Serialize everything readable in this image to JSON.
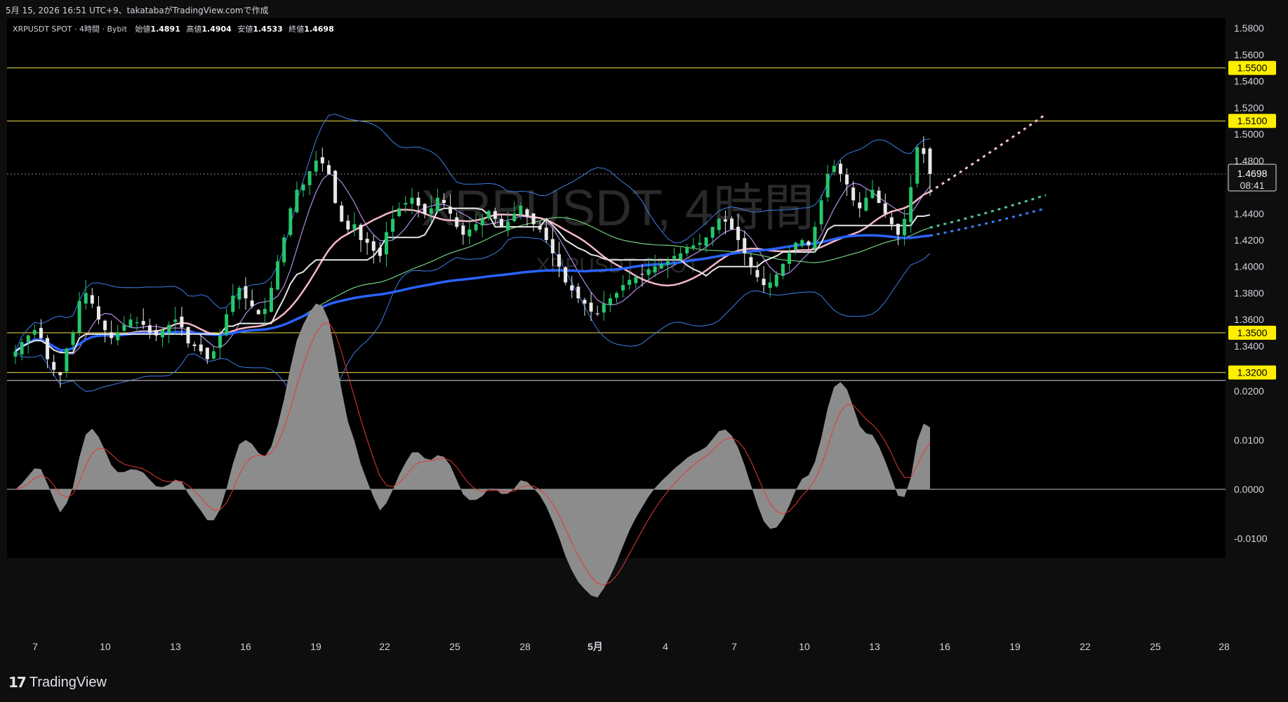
{
  "header": {
    "attribution": "5月 15, 2026 16:51 UTC+9、takatabaがTradingView.comで作成"
  },
  "legend": {
    "symbol": "XRPUSDT SPOT · 4時間 · Bybit",
    "open_label": "始値",
    "open": "1.4891",
    "high_label": "高値",
    "high": "1.4904",
    "low_label": "安値",
    "low": "1.4533",
    "close_label": "終値",
    "close": "1.4698"
  },
  "watermark": {
    "main": "XRPUSDT, 4時間",
    "sub": "XRPUSDT SPOT"
  },
  "footer": {
    "brand": "TradingView"
  },
  "colors": {
    "up": "#26c66a",
    "down": "#e8e8e8",
    "hline": "#f2e34a",
    "tag_bg": "#ffee00",
    "ma_pink": "#f7b7c8",
    "ma_blue": "#2962ff",
    "bb": "#3d7ee8",
    "ma_green": "#6fcf7c",
    "ichimoku": "#e6e6e6",
    "dotted_pink": "#f9c0cb",
    "dotted_teal": "#4fc3a0",
    "dotted_blue": "#3a7cf0"
  },
  "chart_data": [
    {
      "type": "candlestick",
      "timeframe": "4時間",
      "x_ticks": [
        "7",
        "10",
        "13",
        "16",
        "19",
        "22",
        "25",
        "28",
        "5月",
        "4",
        "7",
        "10",
        "13",
        "16",
        "19",
        "22",
        "25",
        "28"
      ],
      "y_ticks": [
        "1.5800",
        "1.5600",
        "1.5400",
        "1.5200",
        "1.5000",
        "1.4800",
        "1.4600",
        "1.4400",
        "1.4200",
        "1.4000",
        "1.3800",
        "1.3600",
        "1.3400"
      ],
      "ylim": [
        1.3145,
        1.5875
      ],
      "horizontal_levels": [
        {
          "value": 1.55,
          "label": "1.5500"
        },
        {
          "value": 1.51,
          "label": "1.5100"
        },
        {
          "value": 1.35,
          "label": "1.3500"
        },
        {
          "value": 1.32,
          "label": "1.3200"
        }
      ],
      "last_price": {
        "value": 1.4698,
        "label": "1.4698",
        "countdown": "08:41"
      },
      "ohlc_last": {
        "open": 1.4891,
        "high": 1.4904,
        "low": 1.4533,
        "close": 1.4698
      },
      "closes_approx": [
        1.336,
        1.343,
        1.348,
        1.352,
        1.346,
        1.33,
        1.322,
        1.318,
        1.338,
        1.35,
        1.374,
        1.38,
        1.372,
        1.36,
        1.352,
        1.346,
        1.35,
        1.356,
        1.36,
        1.358,
        1.356,
        1.35,
        1.348,
        1.352,
        1.356,
        1.36,
        1.354,
        1.342,
        1.34,
        1.336,
        1.33,
        1.336,
        1.348,
        1.364,
        1.378,
        1.384,
        1.376,
        1.37,
        1.364,
        1.368,
        1.384,
        1.404,
        1.422,
        1.444,
        1.458,
        1.462,
        1.472,
        1.48,
        1.478,
        1.47,
        1.448,
        1.434,
        1.428,
        1.432,
        1.42,
        1.418,
        1.412,
        1.408,
        1.426,
        1.436,
        1.444,
        1.448,
        1.452,
        1.446,
        1.44,
        1.444,
        1.452,
        1.448,
        1.44,
        1.43,
        1.424,
        1.428,
        1.432,
        1.436,
        1.442,
        1.436,
        1.43,
        1.434,
        1.44,
        1.446,
        1.438,
        1.432,
        1.428,
        1.42,
        1.41,
        1.4,
        1.388,
        1.382,
        1.376,
        1.372,
        1.366,
        1.364,
        1.372,
        1.376,
        1.38,
        1.386,
        1.39,
        1.392,
        1.394,
        1.398,
        1.4,
        1.402,
        1.404,
        1.408,
        1.41,
        1.414,
        1.416,
        1.418,
        1.422,
        1.43,
        1.436,
        1.434,
        1.428,
        1.42,
        1.41,
        1.4,
        1.392,
        1.386,
        1.388,
        1.394,
        1.402,
        1.41,
        1.418,
        1.42,
        1.416,
        1.43,
        1.45,
        1.47,
        1.476,
        1.47,
        1.462,
        1.45,
        1.444,
        1.452,
        1.458,
        1.448,
        1.44,
        1.432,
        1.424,
        1.436,
        1.46,
        1.49,
        1.485,
        1.4698
      ],
      "indicator": {
        "type": "area",
        "y_ticks": [
          "0.0200",
          "0.0100",
          "0.0000",
          "-0.0100"
        ],
        "ylim": [
          -0.014,
          0.022
        ]
      }
    }
  ]
}
